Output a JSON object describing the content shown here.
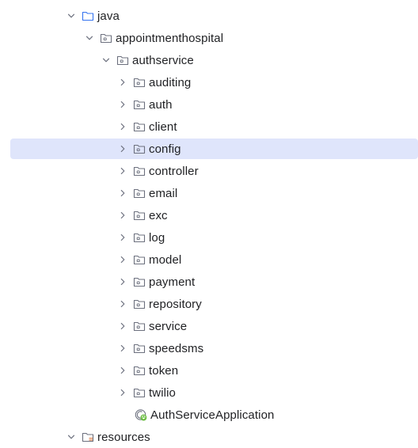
{
  "tree": {
    "java": {
      "label": "java",
      "expanded": true,
      "icon": "folder-icon"
    },
    "appointmenthospital": {
      "label": "appointmenthospital",
      "expanded": true,
      "icon": "package-icon"
    },
    "authservice": {
      "label": "authservice",
      "expanded": true,
      "icon": "package-icon"
    },
    "packages": [
      {
        "label": "auditing",
        "selected": false
      },
      {
        "label": "auth",
        "selected": false
      },
      {
        "label": "client",
        "selected": false
      },
      {
        "label": "config",
        "selected": true
      },
      {
        "label": "controller",
        "selected": false
      },
      {
        "label": "email",
        "selected": false
      },
      {
        "label": "exc",
        "selected": false
      },
      {
        "label": "log",
        "selected": false
      },
      {
        "label": "model",
        "selected": false
      },
      {
        "label": "payment",
        "selected": false
      },
      {
        "label": "repository",
        "selected": false
      },
      {
        "label": "service",
        "selected": false
      },
      {
        "label": "speedsms",
        "selected": false
      },
      {
        "label": "token",
        "selected": false
      },
      {
        "label": "twilio",
        "selected": false
      }
    ],
    "app_class": {
      "label": "AuthServiceApplication",
      "icon": "spring-boot-class-icon"
    },
    "resources": {
      "label": "resources",
      "expanded": true,
      "icon": "resources-folder-icon"
    }
  },
  "colors": {
    "selection": "#dfe5fb",
    "icon_stroke": "#6c707e",
    "folder_blue": "#3574f0",
    "spring_green": "#5fb832",
    "resources_accent": "#e08855"
  }
}
